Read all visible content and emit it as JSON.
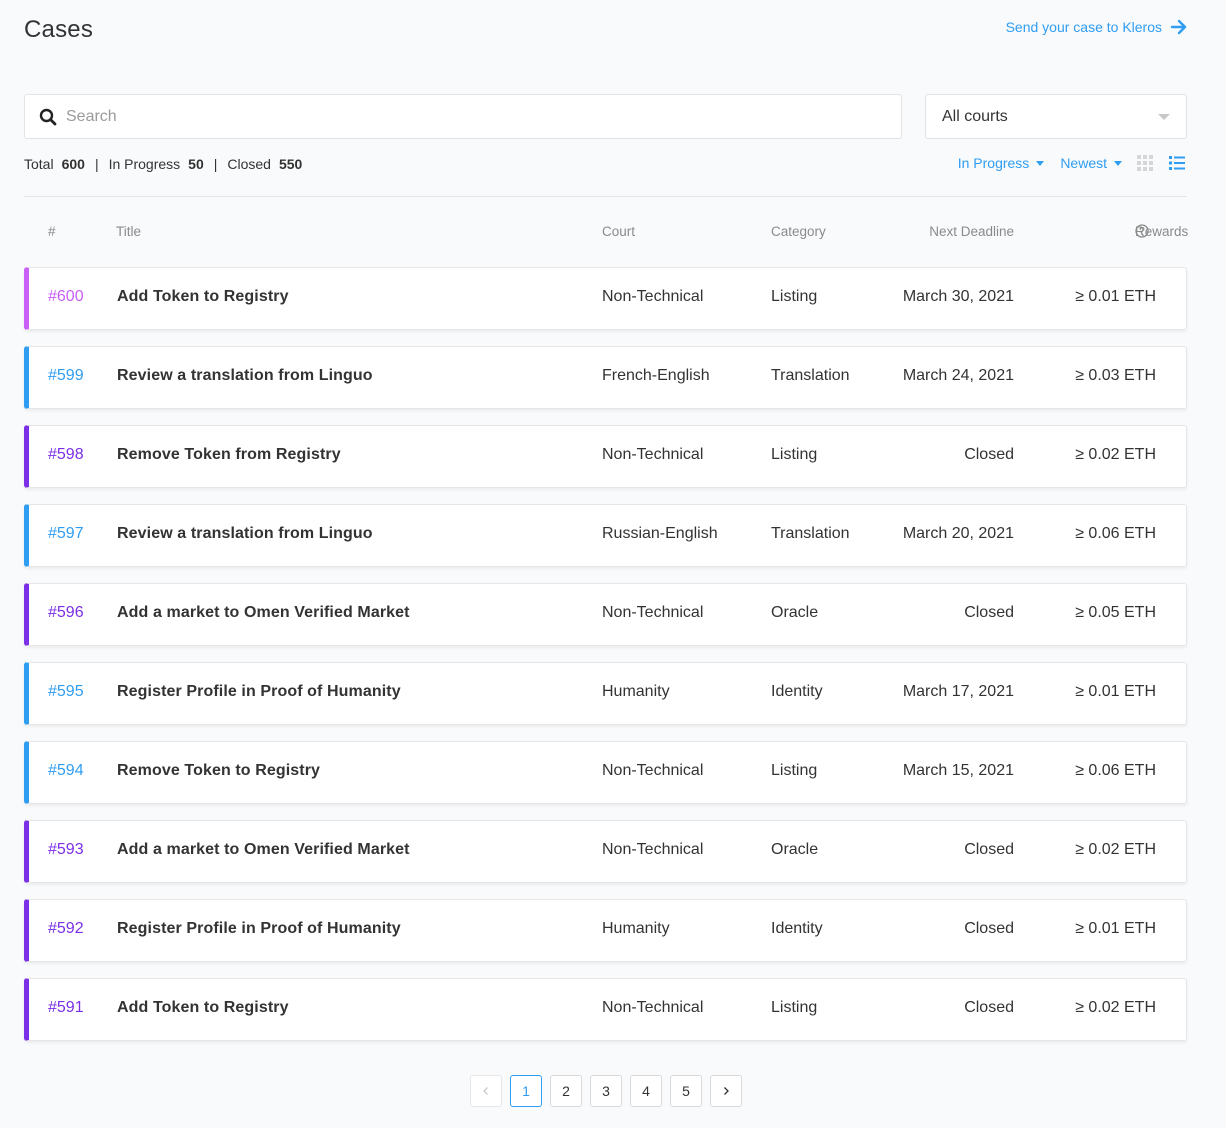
{
  "header": {
    "title": "Cases",
    "send_link": "Send your case to Kleros",
    "send_icon": "arrow-right-icon"
  },
  "search": {
    "placeholder": "Search",
    "value": ""
  },
  "court_select": {
    "value": "All courts"
  },
  "stats": {
    "total_label": "Total",
    "total": "600",
    "in_progress_label": "In Progress",
    "in_progress": "50",
    "closed_label": "Closed",
    "closed": "550",
    "separator": "|"
  },
  "filters": {
    "status": "In Progress",
    "sort": "Newest"
  },
  "table": {
    "headers": {
      "num": "#",
      "title": "Title",
      "court": "Court",
      "category": "Category",
      "deadline": "Next Deadline",
      "rewards": "Rewards"
    },
    "rows": [
      {
        "num": "#600",
        "title": "Add Token to Registry",
        "court": "Non-Technical",
        "category": "Listing",
        "deadline": "March 30, 2021",
        "rewards": "≥ 0.01 ETH",
        "accent": "#c95ff6"
      },
      {
        "num": "#599",
        "title": "Review a translation from Linguo",
        "court": "French-English",
        "category": "Translation",
        "deadline": "March 24, 2021",
        "rewards": "≥ 0.03 ETH",
        "accent": "#2f9df2"
      },
      {
        "num": "#598",
        "title": "Remove Token from Registry",
        "court": "Non-Technical",
        "category": "Listing",
        "deadline": "Closed",
        "rewards": "≥ 0.02 ETH",
        "accent": "#7b2fe6"
      },
      {
        "num": "#597",
        "title": "Review a translation from Linguo",
        "court": "Russian-English",
        "category": "Translation",
        "deadline": "March 20, 2021",
        "rewards": "≥ 0.06 ETH",
        "accent": "#2f9df2"
      },
      {
        "num": "#596",
        "title": "Add a market to Omen Verified Market",
        "court": "Non-Technical",
        "category": "Oracle",
        "deadline": "Closed",
        "rewards": "≥ 0.05 ETH",
        "accent": "#7b2fe6"
      },
      {
        "num": "#595",
        "title": "Register Profile in Proof of Humanity",
        "court": "Humanity",
        "category": "Identity",
        "deadline": "March 17, 2021",
        "rewards": "≥ 0.01 ETH",
        "accent": "#2f9df2"
      },
      {
        "num": "#594",
        "title": "Remove Token to Registry",
        "court": "Non-Technical",
        "category": "Listing",
        "deadline": "March 15, 2021",
        "rewards": "≥ 0.06 ETH",
        "accent": "#2f9df2"
      },
      {
        "num": "#593",
        "title": "Add a market to Omen Verified Market",
        "court": "Non-Technical",
        "category": "Oracle",
        "deadline": "Closed",
        "rewards": "≥ 0.02 ETH",
        "accent": "#7b2fe6"
      },
      {
        "num": "#592",
        "title": "Register Profile in Proof of Humanity",
        "court": "Humanity",
        "category": "Identity",
        "deadline": "Closed",
        "rewards": "≥ 0.01 ETH",
        "accent": "#7b2fe6"
      },
      {
        "num": "#591",
        "title": "Add Token to Registry",
        "court": "Non-Technical",
        "category": "Listing",
        "deadline": "Closed",
        "rewards": "≥ 0.02 ETH",
        "accent": "#7b2fe6"
      }
    ]
  },
  "pagination": {
    "pages": [
      "1",
      "2",
      "3",
      "4",
      "5"
    ],
    "current": "1"
  },
  "colors": {
    "accent_blue": "#2f9df2",
    "accent_purple": "#7b2fe6",
    "accent_pink": "#c95ff6"
  }
}
